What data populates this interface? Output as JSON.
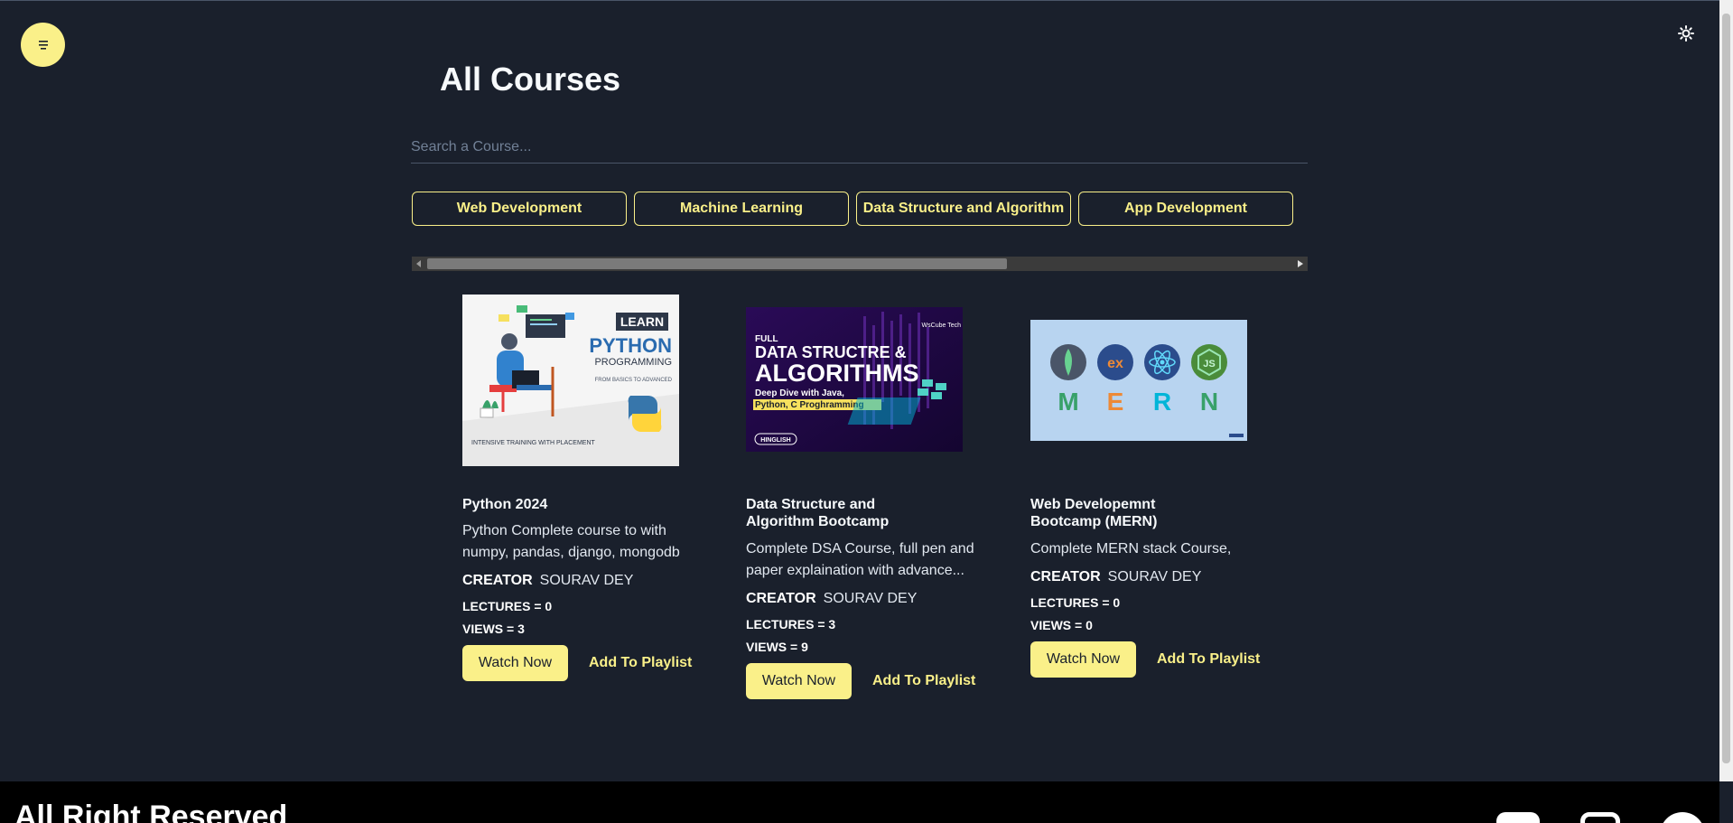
{
  "page": {
    "title": "All Courses"
  },
  "header": {
    "menu_icon": "menu-icon",
    "theme_icon": "sun-icon"
  },
  "search": {
    "placeholder": "Search a Course..."
  },
  "categories": [
    "Web Development",
    "Machine Learning",
    "Data Structure and Algorithm",
    "App Development"
  ],
  "colors": {
    "background": "#1a202c",
    "accent": "#faf089",
    "footer": "#000000"
  },
  "courses": [
    {
      "title": "Python 2024",
      "description": "Python Complete course to with numpy, pandas, django, mongodb",
      "creator_label": "CREATOR",
      "creator": "SOURAV DEY",
      "lectures": "LECTURES = 0",
      "views": "VIEWS = 3",
      "watch_label": "Watch Now",
      "playlist_label": "Add To Playlist",
      "poster": {
        "badge": "LEARN",
        "heading": "PYTHON",
        "sub": "PROGRAMMING",
        "sub2": "FROM BASICS TO ADVANCED",
        "foot": "INTENSIVE TRAINING WITH PLACEMENT"
      }
    },
    {
      "title": "Data Structure and Algorithm Bootcamp",
      "description": "Complete DSA Course, full pen and paper explaination with advance...",
      "creator_label": "CREATOR",
      "creator": "SOURAV DEY",
      "lectures": "LECTURES = 3",
      "views": "VIEWS = 9",
      "watch_label": "Watch Now",
      "playlist_label": "Add To Playlist",
      "poster": {
        "brand": "WsCube Tech",
        "line1": "FULL",
        "line2": "DATA STRUCTRE &",
        "line3": "ALGORITHMS",
        "line4": "Deep Dive with Java,",
        "line5": "Python, C Proghramming",
        "tag": "HINGLISH"
      }
    },
    {
      "title": "Web Developemnt Bootcamp (MERN)",
      "description": "Complete MERN stack Course,",
      "creator_label": "CREATOR",
      "creator": "SOURAV DEY",
      "lectures": "LECTURES = 0",
      "views": "VIEWS = 0",
      "watch_label": "Watch Now",
      "playlist_label": "Add To Playlist",
      "poster": {
        "letters": [
          "M",
          "E",
          "R",
          "N"
        ],
        "ex": "ex",
        "js": "JS"
      }
    }
  ],
  "footer": {
    "text": "All Right Reserved"
  }
}
